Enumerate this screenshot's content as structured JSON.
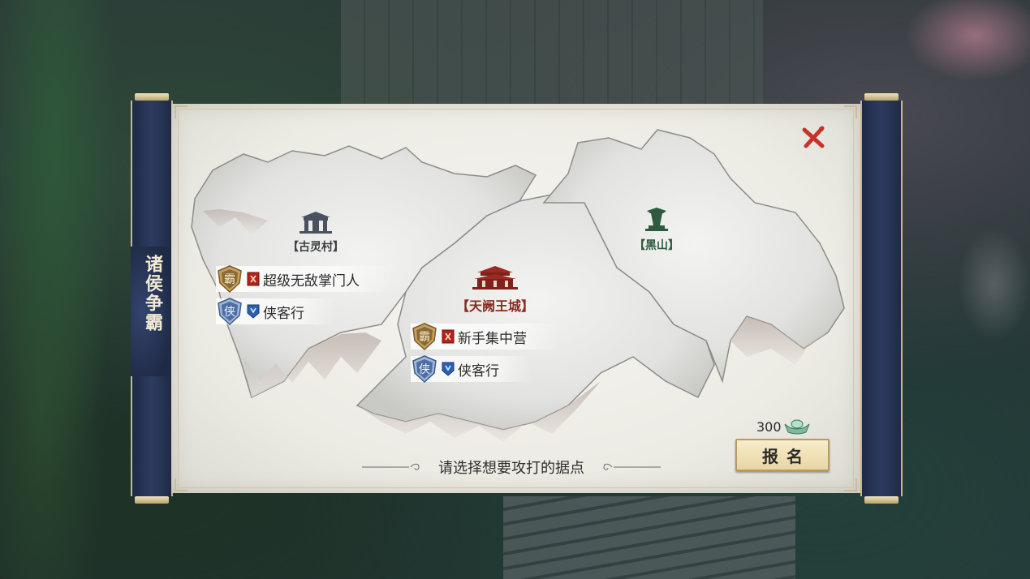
{
  "panel": {
    "title": "诸侯争霸",
    "hint": "请选择想要攻打的据点"
  },
  "locations": [
    {
      "id": "ancient-village",
      "name": "【古灵村】",
      "icon": "gate-icon",
      "color": "#3b3f44",
      "owners": [
        {
          "rank_icon": "ba-shield-icon",
          "rank_char": "霸",
          "flag_icon": "red-flag-icon",
          "guild": "超级无敌掌门人"
        },
        {
          "rank_icon": "xia-shield-icon",
          "rank_char": "侠",
          "flag_icon": "blue-flag-icon",
          "guild": "侠客行"
        }
      ]
    },
    {
      "id": "capital",
      "name": "【天阙王城】",
      "icon": "palace-icon",
      "color": "#8a2b22",
      "owners": [
        {
          "rank_icon": "ba-shield-icon",
          "rank_char": "霸",
          "flag_icon": "red-flag-icon",
          "guild": "新手集中营"
        },
        {
          "rank_icon": "xia-shield-icon",
          "rank_char": "侠",
          "flag_icon": "blue-flag-icon",
          "guild": "侠客行"
        }
      ]
    },
    {
      "id": "black-mountain",
      "name": "【黑山】",
      "icon": "tower-icon",
      "color": "#2e5a3e",
      "owners": []
    }
  ],
  "signup": {
    "cost": "300",
    "currency_icon": "silver-ingot-icon",
    "button_label": "报名"
  },
  "colors": {
    "frame_rod": "#2d3b60",
    "paper": "#f6f5f0",
    "close": "#c8322a",
    "button_bg": "#f8eccb"
  }
}
